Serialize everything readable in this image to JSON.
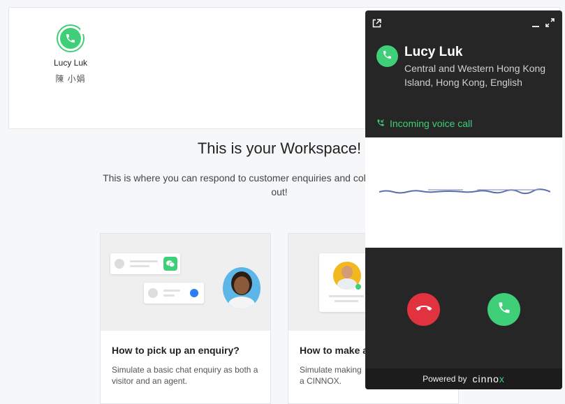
{
  "caller_tile": {
    "name": "Lucy Luk",
    "sub_name": "陳 小娟"
  },
  "workspace": {
    "title": "This is your Workspace!",
    "desc_line1": "This is where you can respond to customer enquiries and collaborate with your co",
    "desc_line2": "out!"
  },
  "guides": [
    {
      "title": "How to pick up an enquiry?",
      "desc": "Simulate a basic chat enquiry as both a visitor and an agent."
    },
    {
      "title": "How to make a",
      "desc": "Simulate making a CINNOX."
    }
  ],
  "call_widget": {
    "name": "Lucy Luk",
    "location": "Central and Western Hong Kong Island, Hong Kong, English",
    "status": "Incoming voice call",
    "footer_powered": "Powered by",
    "brand": "cinno",
    "brand_x": "x"
  },
  "colors": {
    "accent_green": "#3ecf78",
    "decline_red": "#e0333f",
    "widget_bg": "#262626"
  },
  "icons": {
    "phone": "phone-icon",
    "phone_hangup": "phone-hangup-icon",
    "popout": "popout-icon",
    "minimize": "minimize-icon",
    "expand": "expand-icon"
  }
}
